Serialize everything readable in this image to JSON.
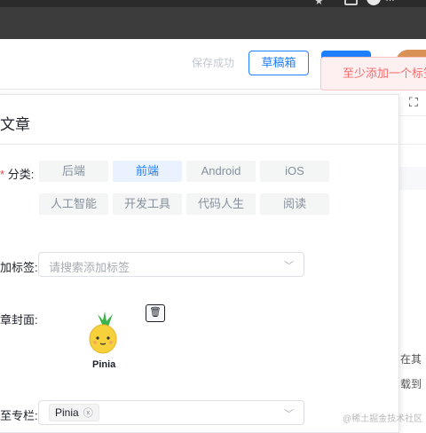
{
  "browser": {
    "user_name": "…"
  },
  "header": {
    "save_status": "保存成功",
    "draft_label": "草稿箱",
    "publish_label": ""
  },
  "toast": {
    "message": "至少添加一个标签"
  },
  "panel": {
    "title": "文章",
    "category": {
      "label": "分类:",
      "options": [
        "后端",
        "前端",
        "Android",
        "iOS",
        "人工智能",
        "开发工具",
        "代码人生",
        "阅读"
      ],
      "selected": "前端"
    },
    "tags": {
      "label": "加标签:",
      "placeholder": "请搜索添加标签"
    },
    "cover": {
      "label": "章封面:",
      "caption": "Pinia"
    },
    "column": {
      "label": "至专栏:",
      "chip": "Pinia"
    }
  },
  "editor_right": {
    "line1": "在其",
    "line2": "载到"
  },
  "watermark": "@稀土掘金技术社区"
}
